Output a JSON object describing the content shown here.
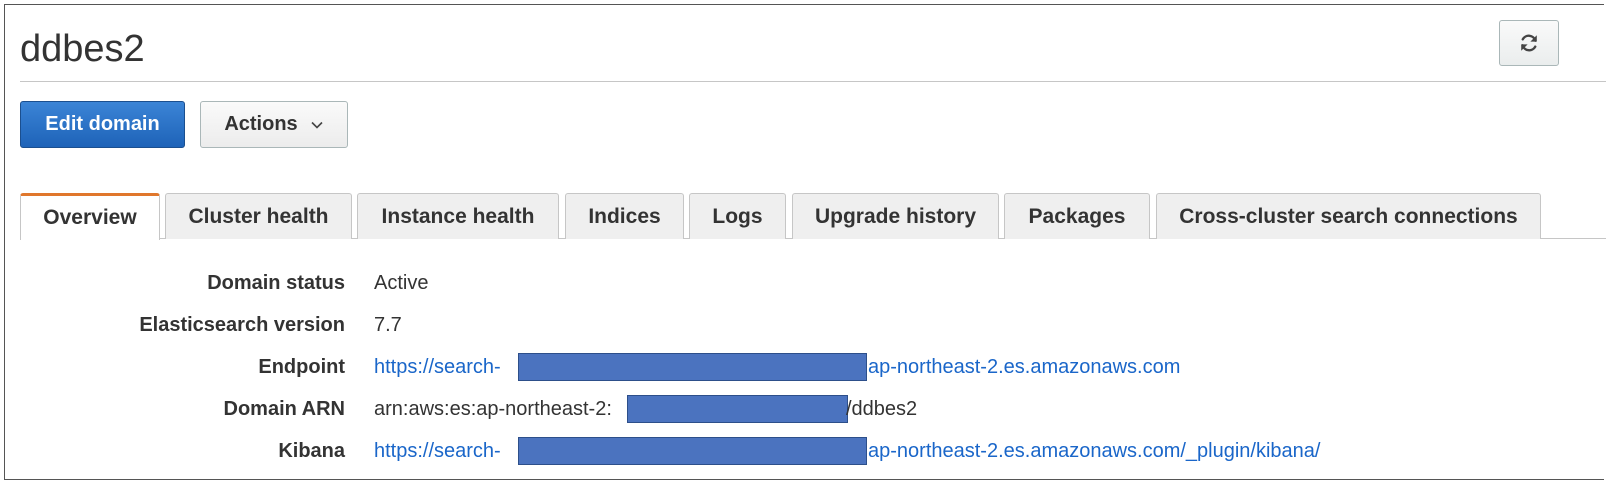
{
  "page": {
    "title": "ddbes2"
  },
  "toolbar": {
    "edit_label": "Edit domain",
    "actions_label": "Actions",
    "refresh_icon": "refresh-icon"
  },
  "tabs": [
    {
      "label": "Overview",
      "active": true
    },
    {
      "label": "Cluster health",
      "active": false
    },
    {
      "label": "Instance health",
      "active": false
    },
    {
      "label": "Indices",
      "active": false
    },
    {
      "label": "Logs",
      "active": false
    },
    {
      "label": "Upgrade history",
      "active": false
    },
    {
      "label": "Packages",
      "active": false
    },
    {
      "label": "Cross-cluster search connections",
      "active": false
    }
  ],
  "overview": {
    "domain_status": {
      "label": "Domain status",
      "value": "Active"
    },
    "es_version": {
      "label": "Elasticsearch version",
      "value": "7.7"
    },
    "endpoint": {
      "label": "Endpoint",
      "prefix": "https://search-",
      "suffix": "ap-northeast-2.es.amazonaws.com"
    },
    "domain_arn": {
      "label": "Domain ARN",
      "prefix": "arn:aws:es:ap-northeast-2:",
      "suffix": "/ddbes2"
    },
    "kibana": {
      "label": "Kibana",
      "prefix": "https://search-",
      "suffix": "ap-northeast-2.es.amazonaws.com/_plugin/kibana/"
    }
  },
  "colors": {
    "primary": "#1e63b8",
    "active_tab_accent": "#e0772c",
    "status_active": "#2f9e2f",
    "link": "#1a66c9",
    "redaction": "#4b73bf"
  }
}
